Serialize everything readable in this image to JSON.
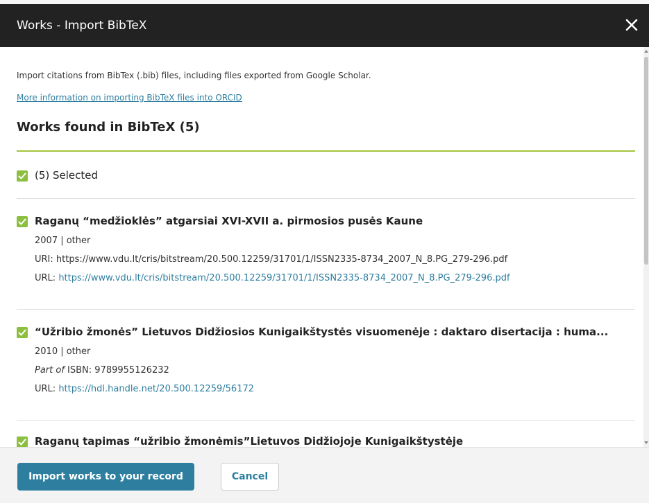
{
  "dialog": {
    "title": "Works - Import BibTeX",
    "close_icon": "close-icon"
  },
  "intro": {
    "text": "Import citations from BibTex (.bib) files, including files exported from Google Scholar.",
    "more_info_link": "More information on importing BibTeX files into ORCID"
  },
  "works_found": {
    "heading": "Works found in BibTeX (5)",
    "select_all_label": "(5) Selected",
    "select_all_checked": true
  },
  "works": [
    {
      "title": "Raganų “medžioklės” atgarsiai XVI-XVII a. pirmosios pusės Kaune",
      "meta": "2007 | other",
      "uri_label": "URI: ",
      "uri_value": "https://www.vdu.lt/cris/bitstream/20.500.12259/31701/1/ISSN2335-8734_2007_N_8.PG_279-296.pdf",
      "url_label": "URL: ",
      "url_value": "https://www.vdu.lt/cris/bitstream/20.500.12259/31701/1/ISSN2335-8734_2007_N_8.PG_279-296.pdf",
      "checked": true
    },
    {
      "title": "“Užribio žmonės” Lietuvos Didžiosios Kunigaikštystės visuomenėje : daktaro disertacija : huma...",
      "meta": "2010 | other",
      "part_of_label": "Part of",
      "isbn_value": " ISBN: 9789955126232",
      "url_label": "URL: ",
      "url_value": "https://hdl.handle.net/20.500.12259/56172",
      "checked": true
    },
    {
      "title": "Raganų tapimas “užribio žmonėmis”Lietuvos Didžiojoje Kunigaikštystėje",
      "checked": true
    }
  ],
  "footer": {
    "import_button": "Import works to your record",
    "cancel_button": "Cancel"
  },
  "colors": {
    "title_bar": "#222222",
    "accent_link": "#2e7f9f",
    "checkbox_green": "#8cbf3f",
    "divider_green": "#a4c43c",
    "footer_bg": "#f3f3f3"
  }
}
